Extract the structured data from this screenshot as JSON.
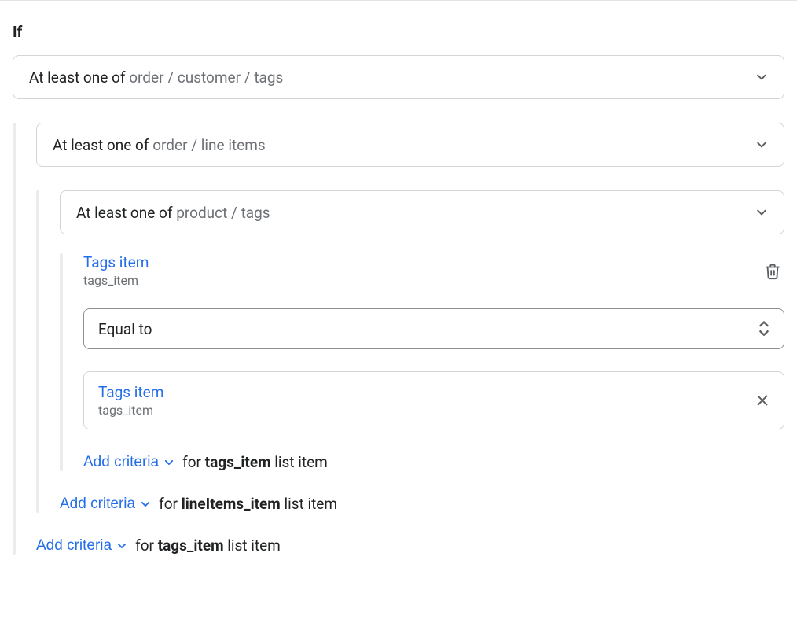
{
  "header": {
    "if_label": "If"
  },
  "row_level1": {
    "prefix": "At least one of ",
    "path": "order / customer / tags"
  },
  "row_level2": {
    "prefix": "At least one of ",
    "path": "order / line items"
  },
  "row_level3": {
    "prefix": "At least one of ",
    "path": "product / tags"
  },
  "criteria": {
    "field": {
      "title": "Tags item",
      "code": "tags_item"
    },
    "operator": {
      "label": "Equal to"
    },
    "value": {
      "title": "Tags item",
      "code": "tags_item"
    }
  },
  "add_lines": {
    "level3": {
      "btn": "Add criteria",
      "for_pre": "for ",
      "for_key": "tags_item",
      "for_post": " list item"
    },
    "level2": {
      "btn": "Add criteria",
      "for_pre": "for ",
      "for_key": "lineItems_item",
      "for_post": " list item"
    },
    "level1": {
      "btn": "Add criteria",
      "for_pre": "for ",
      "for_key": "tags_item",
      "for_post": " list item"
    }
  }
}
